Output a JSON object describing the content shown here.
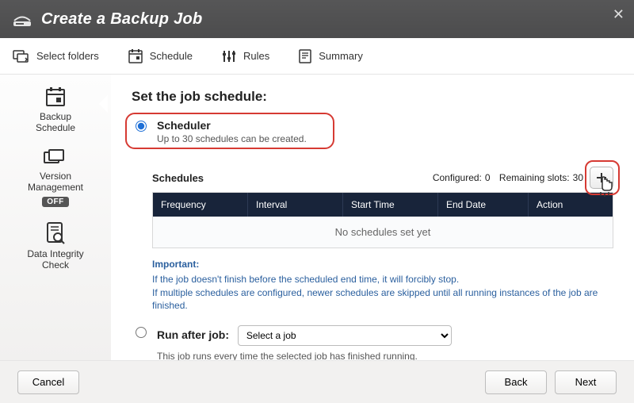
{
  "header": {
    "title": "Create a Backup Job"
  },
  "steps": {
    "select_folders": "Select folders",
    "schedule": "Schedule",
    "rules": "Rules",
    "summary": "Summary"
  },
  "sidebar": {
    "backup_schedule": "Backup\nSchedule",
    "version_management": "Version\nManagement",
    "vm_badge": "OFF",
    "data_integrity": "Data Integrity\nCheck"
  },
  "pane": {
    "heading": "Set the job schedule:",
    "scheduler": {
      "label": "Scheduler",
      "desc": "Up to 30 schedules can be created."
    },
    "schedules_title": "Schedules",
    "configured_label": "Configured:",
    "configured_value": "0",
    "remaining_label": "Remaining slots:",
    "remaining_value": "30",
    "table_headers": {
      "frequency": "Frequency",
      "interval": "Interval",
      "start": "Start Time",
      "end": "End Date",
      "action": "Action"
    },
    "empty_text": "No schedules set yet",
    "important_title": "Important:",
    "important_line1": "If the job doesn't finish before the scheduled end time, it will forcibly stop.",
    "important_line2": "If multiple schedules are configured, newer schedules are skipped until all running instances of the job are finished.",
    "run_after": {
      "label": "Run after job:",
      "placeholder": "Select a job",
      "desc": "This job runs every time the selected job has finished running."
    }
  },
  "footer": {
    "cancel": "Cancel",
    "back": "Back",
    "next": "Next"
  }
}
